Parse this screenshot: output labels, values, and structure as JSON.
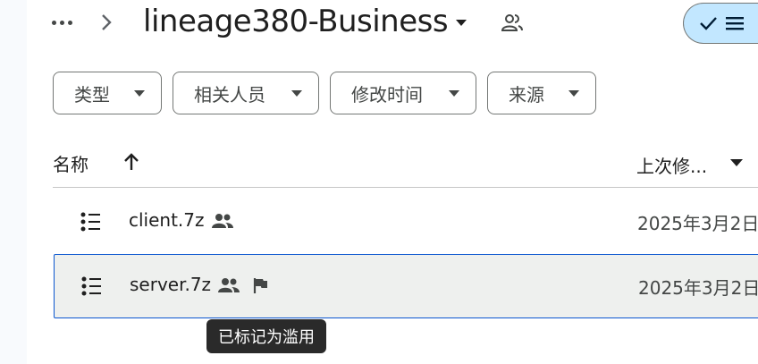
{
  "header": {
    "folder_title": "lineage380-Business"
  },
  "filters": [
    {
      "label": "类型"
    },
    {
      "label": "相关人员"
    },
    {
      "label": "修改时间"
    },
    {
      "label": "来源"
    }
  ],
  "columns": {
    "name": "名称",
    "modified": "上次修..."
  },
  "files": [
    {
      "name": "client.7z",
      "date": "2025年3月2日",
      "shared": true,
      "flagged": false
    },
    {
      "name": "server.7z",
      "date": "2025年3月2日",
      "shared": true,
      "flagged": true
    }
  ],
  "tooltip": {
    "text": "已标记为滥用"
  },
  "colors": {
    "accent_toggle": "#c2e7ff",
    "selected_row_border": "#0b57d0",
    "selected_row_bg": "#eef0ee",
    "tooltip_bg": "#2a2a2a"
  },
  "icons": [
    "more-horiz-icon",
    "chevron-right-icon",
    "dropdown-caret-icon",
    "shared-people-icon",
    "check-icon",
    "list-view-icon",
    "arrow-up-icon",
    "archive-file-icon",
    "flag-icon"
  ]
}
